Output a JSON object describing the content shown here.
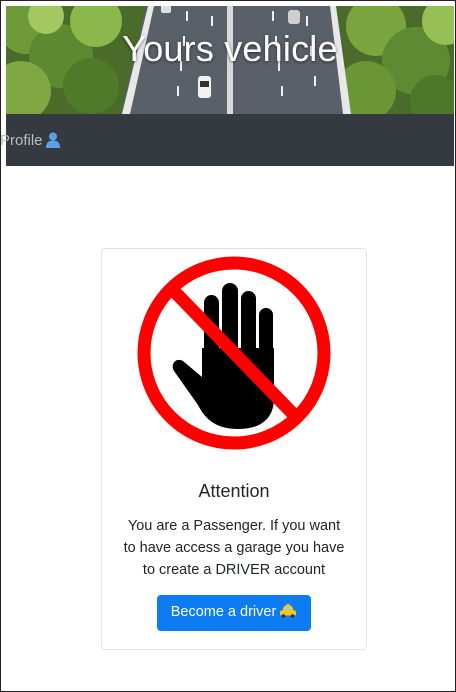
{
  "header": {
    "title": "Yours vehicle",
    "background_icon": "highway-photo"
  },
  "navbar": {
    "profile_label": "Profile",
    "profile_icon": "user-icon"
  },
  "card": {
    "image_icon": "stop-hand-icon",
    "title": "Attention",
    "text_lines": [
      "You are a Passenger. If you want",
      "to have access a garage you have",
      "to create a DRIVER account"
    ],
    "button_label": "Become a driver",
    "button_icon": "taxi-icon"
  },
  "colors": {
    "navbar_bg": "#343a40",
    "primary": "#0d7cf2",
    "stop_red": "#ff0000"
  }
}
